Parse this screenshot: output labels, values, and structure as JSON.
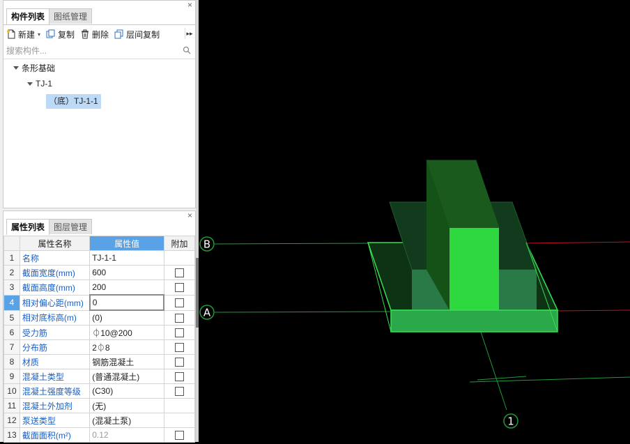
{
  "component_panel": {
    "tabs": [
      "构件列表",
      "图纸管理"
    ],
    "close_glyph": "×",
    "toolbar": {
      "new_label": "新建",
      "copy_label": "复制",
      "delete_label": "删除",
      "floor_copy_label": "层间复制",
      "more_glyph": "▸▸"
    },
    "search_placeholder": "搜索构件...",
    "tree": {
      "root": "条形基础",
      "child": "TJ-1",
      "leaf": "（底）TJ-1-1"
    }
  },
  "property_panel": {
    "tabs": [
      "属性列表",
      "图层管理"
    ],
    "close_glyph": "×",
    "columns": [
      "属性名称",
      "属性值",
      "附加"
    ],
    "rows": [
      {
        "num": "1",
        "name": "名称",
        "value": "TJ-1-1",
        "checkbox": false
      },
      {
        "num": "2",
        "name": "截面宽度(mm)",
        "value": "600",
        "checkbox": true
      },
      {
        "num": "3",
        "name": "截面高度(mm)",
        "value": "200",
        "checkbox": true
      },
      {
        "num": "4",
        "name": "相对偏心距(mm)",
        "value": "0",
        "checkbox": true
      },
      {
        "num": "5",
        "name": "相对底标高(m)",
        "value": "(0)",
        "checkbox": true
      },
      {
        "num": "6",
        "name": "受力筋",
        "value": "⏀10@200",
        "checkbox": true
      },
      {
        "num": "7",
        "name": "分布筋",
        "value": "2⏀8",
        "checkbox": true
      },
      {
        "num": "8",
        "name": "材质",
        "value": "钢筋混凝土",
        "checkbox": true
      },
      {
        "num": "9",
        "name": "混凝土类型",
        "value": "(普通混凝土)",
        "checkbox": true
      },
      {
        "num": "10",
        "name": "混凝土强度等级",
        "value": "(C30)",
        "checkbox": true
      },
      {
        "num": "11",
        "name": "混凝土外加剂",
        "value": "(无)",
        "checkbox": false
      },
      {
        "num": "12",
        "name": "泵送类型",
        "value": "(混凝土泵)",
        "checkbox": false
      },
      {
        "num": "13",
        "name": "截面面积(m²)",
        "value": "0.12",
        "checkbox": true
      }
    ]
  },
  "viewport": {
    "axis_labels": {
      "b": "B",
      "a": "A",
      "one": "1"
    },
    "colors": {
      "background": "#000000",
      "grid_green": "#1f9b3a",
      "axis_red": "#c0141e",
      "model_bright": "#2bd63e",
      "model_dark": "#1f6e22"
    }
  }
}
